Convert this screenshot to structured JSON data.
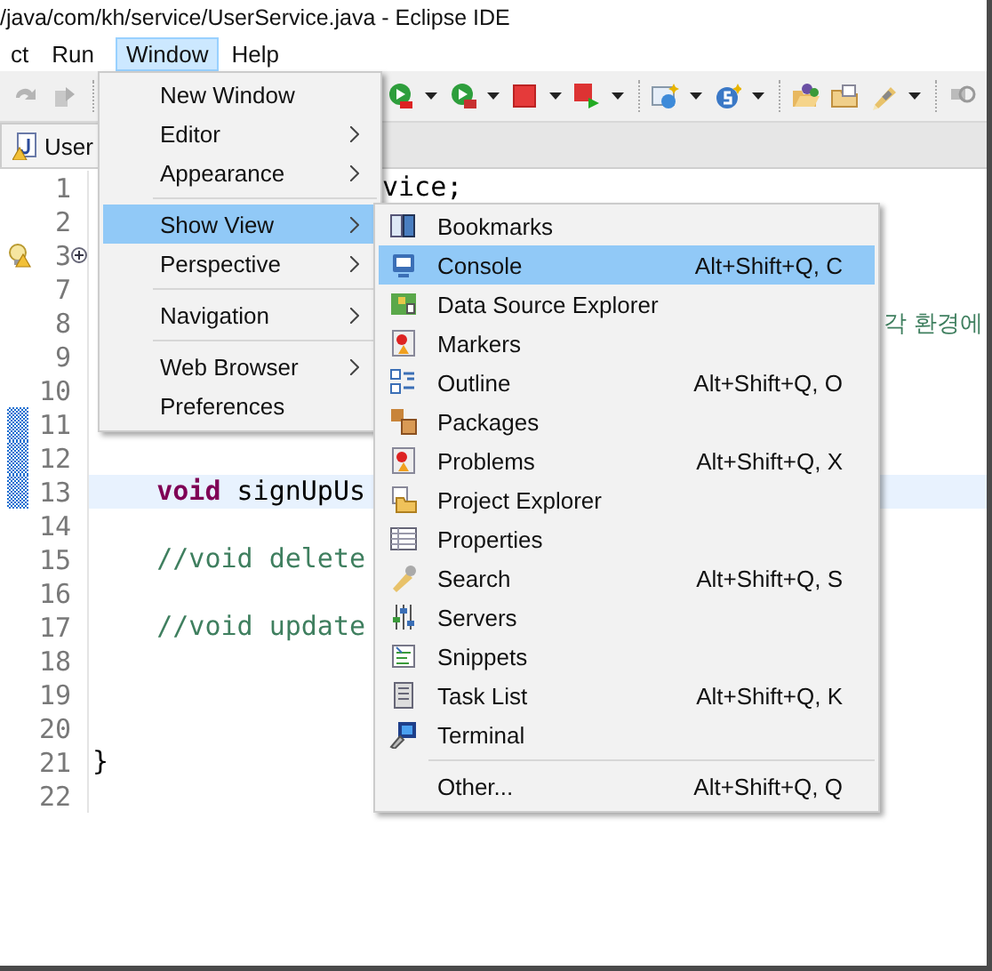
{
  "window": {
    "title": "/java/com/kh/service/UserService.java - Eclipse IDE"
  },
  "menu_bar": [
    {
      "label": "ct",
      "selected": false
    },
    {
      "label": "Run",
      "selected": false
    },
    {
      "label": "Window",
      "selected": true
    },
    {
      "label": "Help",
      "selected": false
    }
  ],
  "editor": {
    "tab": {
      "label": "User"
    },
    "lines": [
      {
        "number": "1",
        "current": false,
        "changed": false,
        "warning": false,
        "folded": false,
        "tail": [
          {
            "text": "vice;",
            "kind": "plain"
          }
        ]
      },
      {
        "number": "2",
        "current": false,
        "changed": false,
        "warning": false,
        "folded": false
      },
      {
        "number": "3",
        "current": false,
        "changed": false,
        "warning": true,
        "folded": true
      },
      {
        "number": "7",
        "current": false,
        "changed": false,
        "warning": false,
        "folded": false
      },
      {
        "number": "8",
        "current": false,
        "changed": false,
        "warning": false,
        "folded": false,
        "tail": [
          {
            "text": "각 환경에",
            "kind": "comment"
          }
        ]
      },
      {
        "number": "9",
        "current": false,
        "changed": false,
        "warning": false,
        "folded": false
      },
      {
        "number": "10",
        "current": false,
        "changed": false,
        "warning": false,
        "folded": false
      },
      {
        "number": "11",
        "current": false,
        "changed": true,
        "warning": false,
        "folded": false
      },
      {
        "number": "12",
        "current": false,
        "changed": true,
        "warning": false,
        "folded": false
      },
      {
        "number": "13",
        "current": true,
        "changed": true,
        "warning": false,
        "folded": false,
        "segments": [
          {
            "text": "    void",
            "kind": "keyword"
          },
          {
            "text": " signUpUs",
            "kind": "plain"
          }
        ]
      },
      {
        "number": "14",
        "current": false,
        "changed": false,
        "warning": false,
        "folded": false
      },
      {
        "number": "15",
        "current": false,
        "changed": false,
        "warning": false,
        "folded": false,
        "segments": [
          {
            "text": "    //void delete",
            "kind": "comment"
          }
        ]
      },
      {
        "number": "16",
        "current": false,
        "changed": false,
        "warning": false,
        "folded": false
      },
      {
        "number": "17",
        "current": false,
        "changed": false,
        "warning": false,
        "folded": false,
        "segments": [
          {
            "text": "    //void update",
            "kind": "comment"
          }
        ]
      },
      {
        "number": "18",
        "current": false,
        "changed": false,
        "warning": false,
        "folded": false
      },
      {
        "number": "19",
        "current": false,
        "changed": false,
        "warning": false,
        "folded": false
      },
      {
        "number": "20",
        "current": false,
        "changed": false,
        "warning": false,
        "folded": false
      },
      {
        "number": "21",
        "current": false,
        "changed": false,
        "warning": false,
        "folded": false,
        "segments": [
          {
            "text": "}",
            "kind": "plain"
          }
        ]
      },
      {
        "number": "22",
        "current": false,
        "changed": false,
        "warning": false,
        "folded": false
      }
    ]
  },
  "window_menu": {
    "items": [
      {
        "kind": "item",
        "label": "New Window",
        "submenu": false,
        "selected": false
      },
      {
        "kind": "item",
        "label": "Editor",
        "submenu": true,
        "selected": false
      },
      {
        "kind": "item",
        "label": "Appearance",
        "submenu": true,
        "selected": false
      },
      {
        "kind": "separator"
      },
      {
        "kind": "item",
        "label": "Show View",
        "submenu": true,
        "selected": true
      },
      {
        "kind": "item",
        "label": "Perspective",
        "submenu": true,
        "selected": false
      },
      {
        "kind": "separator"
      },
      {
        "kind": "item",
        "label": "Navigation",
        "submenu": true,
        "selected": false
      },
      {
        "kind": "separator"
      },
      {
        "kind": "item",
        "label": "Web Browser",
        "submenu": true,
        "selected": false
      },
      {
        "kind": "item",
        "label": "Preferences",
        "submenu": false,
        "selected": false
      }
    ]
  },
  "show_view_menu": {
    "items": [
      {
        "kind": "item",
        "label": "Bookmarks",
        "selected": false
      },
      {
        "kind": "item",
        "label": "Console",
        "shortcut": "Alt+Shift+Q, C",
        "selected": true
      },
      {
        "kind": "item",
        "label": "Data Source Explorer",
        "selected": false
      },
      {
        "kind": "item",
        "label": "Markers",
        "selected": false
      },
      {
        "kind": "item",
        "label": "Outline",
        "shortcut": "Alt+Shift+Q, O",
        "selected": false
      },
      {
        "kind": "item",
        "label": "Packages",
        "selected": false
      },
      {
        "kind": "item",
        "label": "Problems",
        "shortcut": "Alt+Shift+Q, X",
        "selected": false
      },
      {
        "kind": "item",
        "label": "Project Explorer",
        "selected": false
      },
      {
        "kind": "item",
        "label": "Properties",
        "selected": false
      },
      {
        "kind": "item",
        "label": "Search",
        "shortcut": "Alt+Shift+Q, S",
        "selected": false
      },
      {
        "kind": "item",
        "label": "Servers",
        "selected": false
      },
      {
        "kind": "item",
        "label": "Snippets",
        "selected": false
      },
      {
        "kind": "item",
        "label": "Task List",
        "shortcut": "Alt+Shift+Q, K",
        "selected": false
      },
      {
        "kind": "item",
        "label": "Terminal",
        "selected": false
      },
      {
        "kind": "separator"
      },
      {
        "kind": "item",
        "label": "Other...",
        "shortcut": "Alt+Shift+Q, Q",
        "selected": false
      }
    ]
  }
}
